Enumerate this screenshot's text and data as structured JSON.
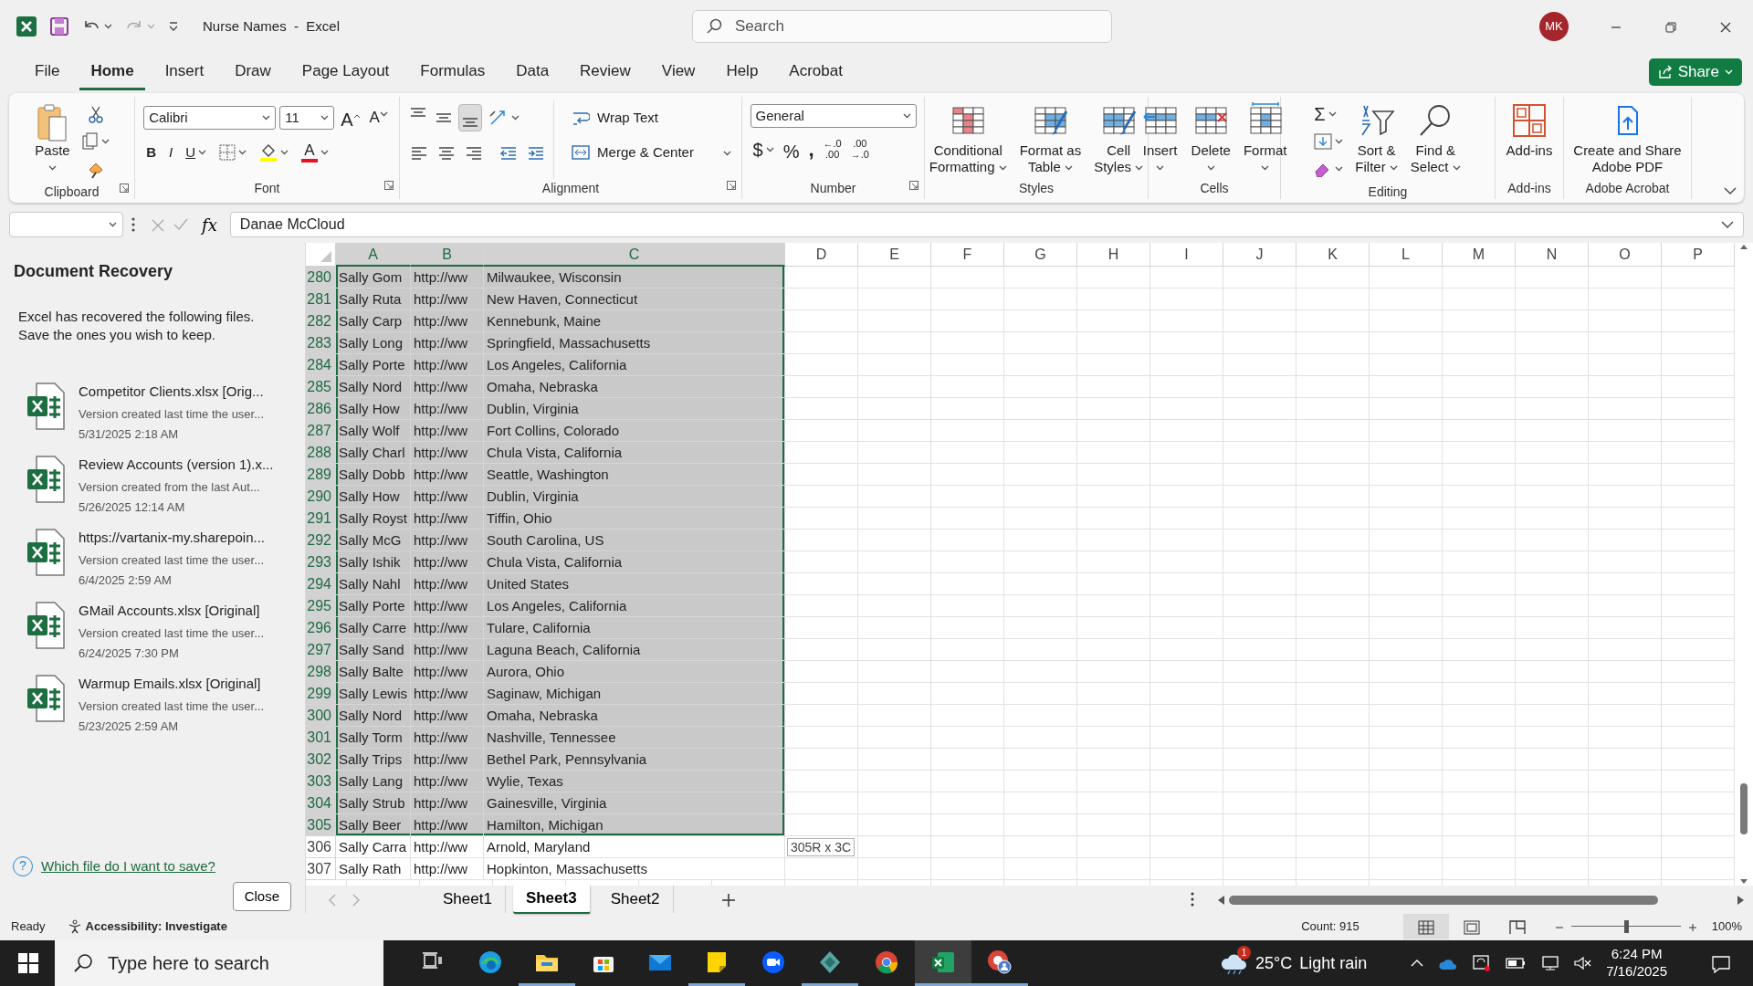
{
  "window": {
    "title": "Nurse Names  -  Excel",
    "search_placeholder": "Search",
    "user_initials": "MK"
  },
  "menu_tabs": [
    {
      "label": "File",
      "selected": false
    },
    {
      "label": "Home",
      "selected": true
    },
    {
      "label": "Insert",
      "selected": false
    },
    {
      "label": "Draw",
      "selected": false
    },
    {
      "label": "Page Layout",
      "selected": false
    },
    {
      "label": "Formulas",
      "selected": false
    },
    {
      "label": "Data",
      "selected": false
    },
    {
      "label": "Review",
      "selected": false
    },
    {
      "label": "View",
      "selected": false
    },
    {
      "label": "Help",
      "selected": false
    },
    {
      "label": "Acrobat",
      "selected": false
    }
  ],
  "share_button": "Share",
  "ribbon": [
    {
      "kind": "clipboard",
      "label": "Clipboard",
      "paste": "Paste"
    },
    {
      "kind": "font",
      "label": "Font",
      "font_name": "Calibri",
      "font_size": "11",
      "grow_font": "A",
      "shrink_font": "A",
      "bold": "B",
      "italic": "I",
      "underline": "U",
      "font_color": "A"
    },
    {
      "kind": "alignment",
      "label": "Alignment",
      "vertical_align": [
        {
          "kind": "top",
          "selected": false
        },
        {
          "kind": "middle",
          "selected": false
        },
        {
          "kind": "bottom",
          "selected": true
        }
      ],
      "wrap_text": "Wrap Text",
      "merge": "Merge & Center"
    },
    {
      "kind": "number",
      "label": "Number",
      "format": "General",
      "currency": "$",
      "percent": "%",
      "comma": ",",
      "increase_decimal": [
        "←.0",
        ".00"
      ],
      "decrease_decimal": [
        ".00",
        "→.0"
      ]
    },
    {
      "kind": "buttons",
      "label": "Styles",
      "buttons": [
        {
          "kind": "conditional_formatting",
          "lines": [
            "Conditional",
            "Formatting"
          ],
          "dropdown": true
        },
        {
          "kind": "format_table",
          "lines": [
            "Format as",
            "Table"
          ],
          "dropdown": true
        },
        {
          "kind": "cell_styles",
          "lines": [
            "Cell",
            "Styles"
          ],
          "dropdown": true
        }
      ]
    },
    {
      "kind": "buttons",
      "label": "Cells",
      "buttons": [
        {
          "kind": "insert",
          "lines": [
            "Insert"
          ],
          "dropdown": true
        },
        {
          "kind": "delete",
          "lines": [
            "Delete"
          ],
          "dropdown": true
        },
        {
          "kind": "format",
          "lines": [
            "Format"
          ],
          "dropdown": true
        }
      ]
    },
    {
      "kind": "editing",
      "label": "Editing",
      "autosum": "Σ",
      "buttons": [
        {
          "kind": "sort_filter",
          "lines": [
            "Sort &",
            "Filter"
          ],
          "dropdown": true
        },
        {
          "kind": "find_select",
          "lines": [
            "Find &",
            "Select"
          ],
          "dropdown": true
        }
      ]
    },
    {
      "kind": "buttons",
      "label": "Add-ins",
      "buttons": [
        {
          "kind": "add_ins",
          "lines": [
            "Add-ins"
          ],
          "dropdown": false
        }
      ]
    },
    {
      "kind": "buttons",
      "label": "Adobe Acrobat",
      "buttons": [
        {
          "kind": "create_pdf",
          "lines": [
            "Create and Share",
            "Adobe PDF"
          ],
          "dropdown": false
        }
      ]
    }
  ],
  "formula_bar": {
    "function_label": "fx",
    "formula": "Danae McCloud"
  },
  "recovery": {
    "title": "Document Recovery",
    "message_lines": [
      "Excel has recovered the following files.",
      "Save the ones you wish to keep."
    ],
    "files": [
      {
        "name": "Competitor Clients.xlsx  [Orig...",
        "description": "Version created last time the user...",
        "date": "5/31/2025 2:18 AM"
      },
      {
        "name": "Review Accounts (version 1).x...",
        "description": "Version created from the last Aut...",
        "date": "5/26/2025 12:14 AM"
      },
      {
        "name": "https://vartanix-my.sharepoin...",
        "description": "Version created last time the user...",
        "date": "6/4/2025 2:59 AM"
      },
      {
        "name": "GMail Accounts.xlsx  [Original]",
        "description": "Version created last time the user...",
        "date": "6/24/2025 7:30 PM"
      },
      {
        "name": "Warmup Emails.xlsx  [Original]",
        "description": "Version created last time the user...",
        "date": "5/23/2025 2:59 AM"
      }
    ],
    "help_icon": "?",
    "help_link": "Which file do I want to save?",
    "close_button": "Close"
  },
  "sheet": {
    "columns": [
      {
        "label": "A",
        "selected": true
      },
      {
        "label": "B",
        "selected": true
      },
      {
        "label": "C",
        "selected": true
      },
      {
        "label": "D",
        "selected": false
      },
      {
        "label": "E",
        "selected": false
      },
      {
        "label": "F",
        "selected": false
      },
      {
        "label": "G",
        "selected": false
      },
      {
        "label": "H",
        "selected": false
      },
      {
        "label": "I",
        "selected": false
      },
      {
        "label": "J",
        "selected": false
      },
      {
        "label": "K",
        "selected": false
      },
      {
        "label": "L",
        "selected": false
      },
      {
        "label": "M",
        "selected": false
      },
      {
        "label": "N",
        "selected": false
      },
      {
        "label": "O",
        "selected": false
      },
      {
        "label": "P",
        "selected": false
      }
    ],
    "rows": [
      {
        "number": "280",
        "cells": [
          "Sally Gom",
          "http://ww",
          "Milwaukee, Wisconsin"
        ],
        "selected": true
      },
      {
        "number": "281",
        "cells": [
          "Sally Ruta",
          "http://ww",
          "New Haven, Connecticut"
        ],
        "selected": true
      },
      {
        "number": "282",
        "cells": [
          "Sally Carp",
          "http://ww",
          "Kennebunk, Maine"
        ],
        "selected": true
      },
      {
        "number": "283",
        "cells": [
          "Sally Long",
          "http://ww",
          "Springfield, Massachusetts"
        ],
        "selected": true
      },
      {
        "number": "284",
        "cells": [
          "Sally Porte",
          "http://ww",
          "Los Angeles, California"
        ],
        "selected": true
      },
      {
        "number": "285",
        "cells": [
          "Sally Nord",
          "http://ww",
          "Omaha, Nebraska"
        ],
        "selected": true
      },
      {
        "number": "286",
        "cells": [
          "Sally How",
          "http://ww",
          "Dublin, Virginia"
        ],
        "selected": true
      },
      {
        "number": "287",
        "cells": [
          "Sally Wolf",
          "http://ww",
          "Fort Collins, Colorado"
        ],
        "selected": true
      },
      {
        "number": "288",
        "cells": [
          "Sally Charl",
          "http://ww",
          "Chula Vista, California"
        ],
        "selected": true
      },
      {
        "number": "289",
        "cells": [
          "Sally Dobb",
          "http://ww",
          "Seattle, Washington"
        ],
        "selected": true
      },
      {
        "number": "290",
        "cells": [
          "Sally How",
          "http://ww",
          "Dublin, Virginia"
        ],
        "selected": true
      },
      {
        "number": "291",
        "cells": [
          "Sally Royst",
          "http://ww",
          "Tiffin, Ohio"
        ],
        "selected": true
      },
      {
        "number": "292",
        "cells": [
          "Sally McG",
          "http://ww",
          "South Carolina, US"
        ],
        "selected": true
      },
      {
        "number": "293",
        "cells": [
          "Sally Ishik",
          "http://ww",
          "Chula Vista, California"
        ],
        "selected": true
      },
      {
        "number": "294",
        "cells": [
          "Sally Nahl",
          "http://ww",
          "United States"
        ],
        "selected": true
      },
      {
        "number": "295",
        "cells": [
          "Sally Porte",
          "http://ww",
          "Los Angeles, California"
        ],
        "selected": true
      },
      {
        "number": "296",
        "cells": [
          "Sally Carre",
          "http://ww",
          "Tulare, California"
        ],
        "selected": true
      },
      {
        "number": "297",
        "cells": [
          "Sally Sand",
          "http://ww",
          "Laguna Beach, California"
        ],
        "selected": true
      },
      {
        "number": "298",
        "cells": [
          "Sally Balte",
          "http://ww",
          "Aurora, Ohio"
        ],
        "selected": true
      },
      {
        "number": "299",
        "cells": [
          "Sally Lewis",
          "http://ww",
          "Saginaw, Michigan"
        ],
        "selected": true
      },
      {
        "number": "300",
        "cells": [
          "Sally Nord",
          "http://ww",
          "Omaha, Nebraska"
        ],
        "selected": true
      },
      {
        "number": "301",
        "cells": [
          "Sally Torm",
          "http://ww",
          "Nashville, Tennessee"
        ],
        "selected": true
      },
      {
        "number": "302",
        "cells": [
          "Sally Trips",
          "http://ww",
          "Bethel Park, Pennsylvania"
        ],
        "selected": true
      },
      {
        "number": "303",
        "cells": [
          "Sally Lang",
          "http://ww",
          "Wylie, Texas"
        ],
        "selected": true
      },
      {
        "number": "304",
        "cells": [
          "Sally Strub",
          "http://ww",
          "Gainesville, Virginia"
        ],
        "selected": true
      },
      {
        "number": "305",
        "cells": [
          "Sally Beer",
          "http://ww",
          "Hamilton, Michigan"
        ],
        "selected": true
      },
      {
        "number": "306",
        "cells": [
          "Sally Carra",
          "http://ww",
          "Arnold, Maryland"
        ],
        "selected": false
      },
      {
        "number": "307",
        "cells": [
          "Sally Rath",
          "http://ww",
          "Hopkinton, Massachusetts"
        ],
        "selected": false
      }
    ],
    "selection_tooltip": "305R x 3C"
  },
  "sheet_tabs": [
    {
      "label": "Sheet1",
      "selected": false
    },
    {
      "label": "Sheet3",
      "selected": true
    },
    {
      "label": "Sheet2",
      "selected": false
    }
  ],
  "status_bar": {
    "mode": "Ready",
    "accessibility": "Accessibility: Investigate",
    "count": "Count: 915",
    "views": [
      {
        "kind": "normal",
        "selected": true
      },
      {
        "kind": "page_layout",
        "selected": false
      },
      {
        "kind": "page_break",
        "selected": false
      }
    ],
    "zoom_slider": {
      "level": 0.5
    },
    "zoom": "100%"
  },
  "taskbar": {
    "search_placeholder": "Type here to search",
    "apps": [
      {
        "kind": "task_view",
        "running": false,
        "selected": false
      },
      {
        "kind": "edge",
        "running": false,
        "selected": false
      },
      {
        "kind": "folder",
        "running": true,
        "selected": false
      },
      {
        "kind": "store",
        "running": false,
        "selected": false
      },
      {
        "kind": "mail",
        "running": false,
        "selected": false
      },
      {
        "kind": "notes",
        "running": true,
        "selected": false
      },
      {
        "kind": "zoom",
        "running": false,
        "selected": false
      },
      {
        "kind": "diamond",
        "running": true,
        "selected": false
      },
      {
        "kind": "chrome",
        "running": false,
        "selected": false
      },
      {
        "kind": "excel",
        "running": true,
        "selected": true
      },
      {
        "kind": "chrome_profile",
        "running": true,
        "selected": false
      }
    ],
    "weather_badge": "1",
    "temperature": "25°C",
    "weather": "Light rain",
    "time": "6:24 PM",
    "date": "7/16/2025"
  }
}
